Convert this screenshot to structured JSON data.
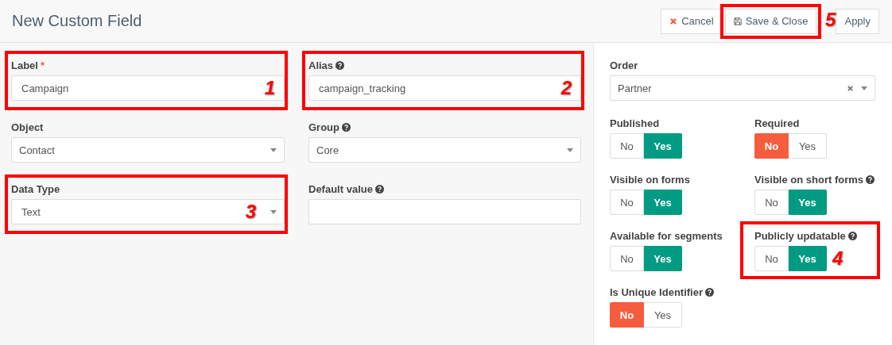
{
  "header": {
    "title": "New Custom Field",
    "buttons": [
      {
        "label": "Cancel",
        "kind": "cancel"
      },
      {
        "label": "Save & Close",
        "kind": "save",
        "callout": "5"
      },
      {
        "label": "Apply",
        "kind": "apply"
      }
    ]
  },
  "fields": [
    {
      "label": "Label",
      "required_mark": "*",
      "kind": "text",
      "value": "Campaign",
      "callout": "1"
    },
    {
      "label": "Alias",
      "help": true,
      "kind": "text",
      "value": "campaign_tracking",
      "callout": "2"
    },
    {
      "label": "Object",
      "kind": "select",
      "value": "Contact"
    },
    {
      "label": "Group",
      "help": true,
      "kind": "select",
      "value": "Core"
    },
    {
      "label": "Data Type",
      "kind": "select",
      "value": "Text",
      "callout": "3"
    },
    {
      "label": "Default value",
      "help": true,
      "kind": "text"
    }
  ],
  "order": {
    "label": "Order",
    "value": "Partner",
    "clearable": true
  },
  "toggles": [
    {
      "label": "Published",
      "no": "No",
      "yes": "Yes",
      "on": true
    },
    {
      "label": "Required",
      "no": "No",
      "yes": "Yes",
      "on": false
    },
    {
      "label": "Visible on forms",
      "no": "No",
      "yes": "Yes",
      "on": true
    },
    {
      "label": "Visible on short forms",
      "help": true,
      "no": "No",
      "yes": "Yes",
      "on": true
    },
    {
      "label": "Available for segments",
      "no": "No",
      "yes": "Yes",
      "on": true
    },
    {
      "label": "Publicly updatable",
      "help": true,
      "no": "No",
      "yes": "Yes",
      "on": true,
      "callout": "4"
    },
    {
      "label": "Is Unique Identifier",
      "help": true,
      "no": "No",
      "yes": "Yes",
      "on": false
    }
  ]
}
